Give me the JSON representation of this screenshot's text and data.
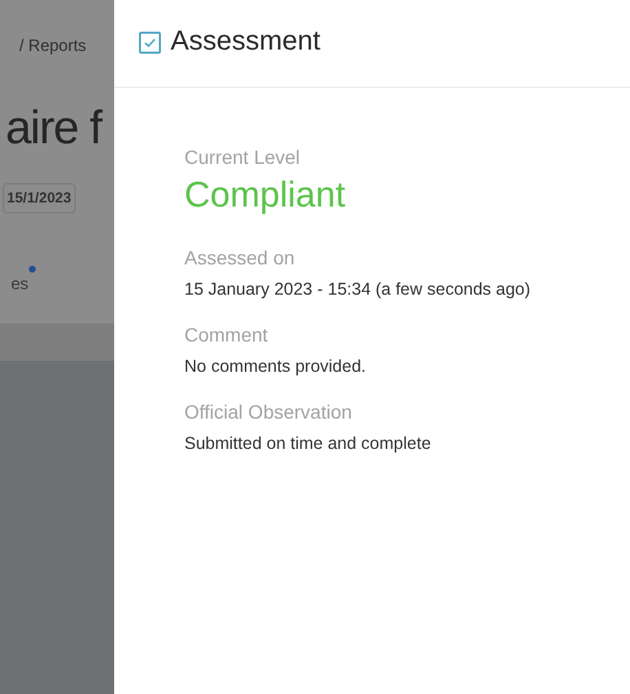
{
  "background_page": {
    "breadcrumb": "/ Reports",
    "title": "aire f",
    "date": "15/1/2023",
    "tab": "es",
    "tab_has_dot": true
  },
  "drawer": {
    "title": "Assessment",
    "title_checked": true,
    "fields": [
      {
        "label": "Current Level",
        "value": "Compliant",
        "kind": "level"
      },
      {
        "label": "Assessed on",
        "value": "15 January 2023 - 15:34 (a few seconds ago)",
        "kind": "text"
      },
      {
        "label": "Comment",
        "value": "No comments provided.",
        "kind": "text"
      },
      {
        "label": "Official Observation",
        "value": "Submitted on time and complete",
        "kind": "text"
      }
    ]
  }
}
